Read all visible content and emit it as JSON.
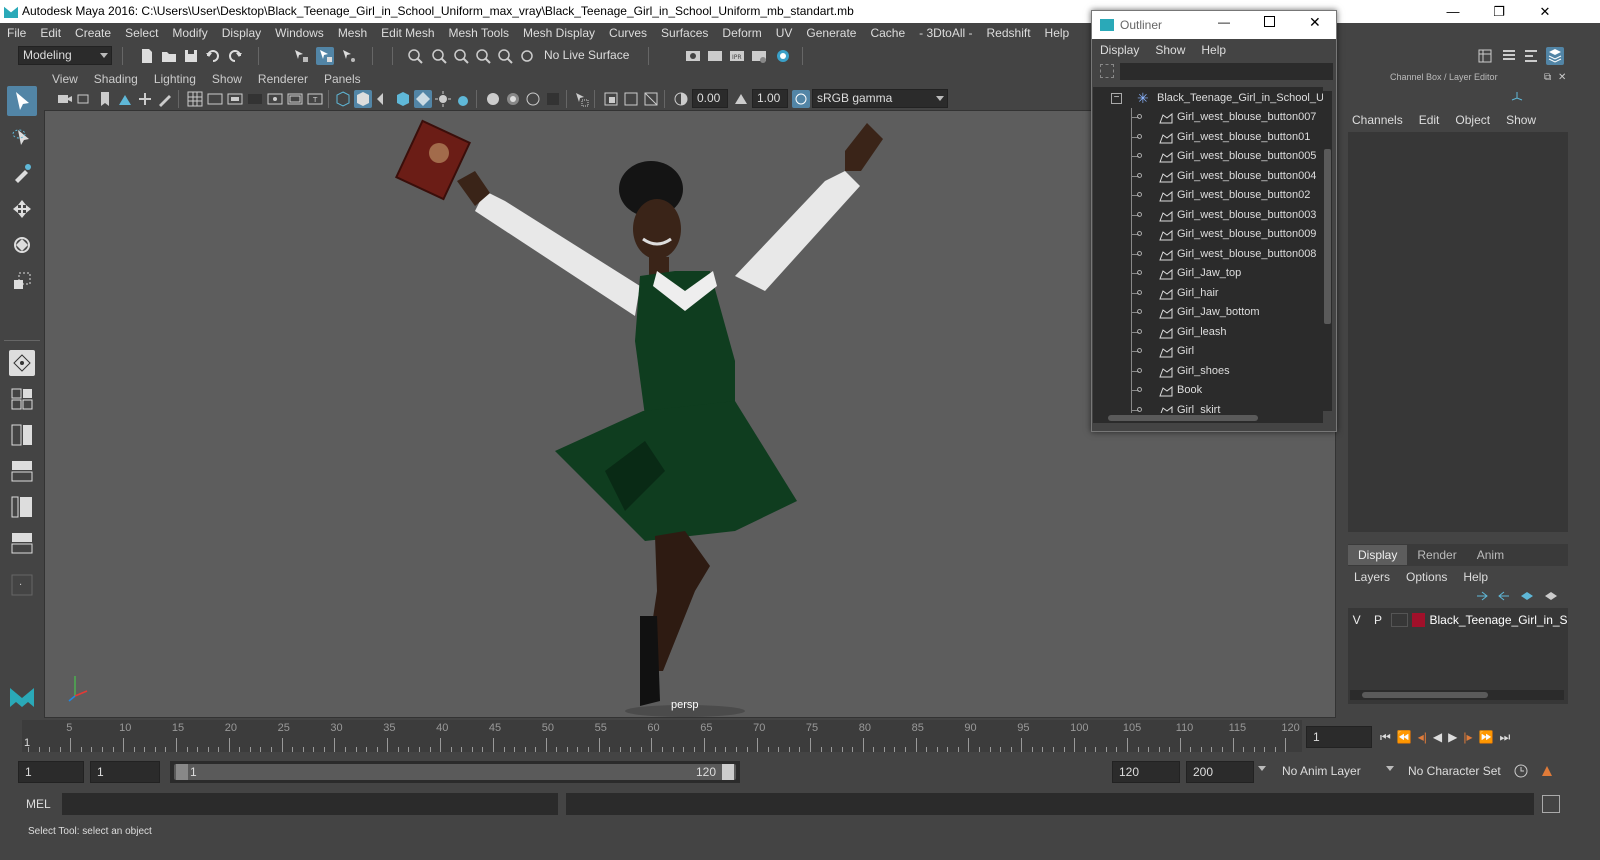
{
  "window": {
    "title": "Autodesk Maya 2016: C:\\Users\\User\\Desktop\\Black_Teenage_Girl_in_School_Uniform_max_vray\\Black_Teenage_Girl_in_School_Uniform_mb_standart.mb",
    "minimize": "—",
    "maximize": "❐",
    "close": "✕"
  },
  "menubar": [
    "File",
    "Edit",
    "Create",
    "Select",
    "Modify",
    "Display",
    "Windows",
    "Mesh",
    "Edit Mesh",
    "Mesh Tools",
    "Mesh Display",
    "Curves",
    "Surfaces",
    "Deform",
    "UV",
    "Generate",
    "Cache",
    "- 3DtoAll -",
    "Redshift",
    "Help"
  ],
  "statusline": {
    "mode": "Modeling",
    "live_surface": "No Live Surface"
  },
  "viewport": {
    "menu": [
      "View",
      "Shading",
      "Lighting",
      "Show",
      "Renderer",
      "Panels"
    ],
    "exposure": "0.00",
    "gamma": "1.00",
    "color_space": "sRGB gamma",
    "camera_label": "persp"
  },
  "outliner": {
    "title": "Outliner",
    "menu": [
      "Display",
      "Show",
      "Help"
    ],
    "root": "Black_Teenage_Girl_in_School_Ur",
    "items": [
      "Girl_west_blouse_button007",
      "Girl_west_blouse_button01",
      "Girl_west_blouse_button005",
      "Girl_west_blouse_button004",
      "Girl_west_blouse_button02",
      "Girl_west_blouse_button003",
      "Girl_west_blouse_button009",
      "Girl_west_blouse_button008",
      "Girl_Jaw_top",
      "Girl_hair",
      "Girl_Jaw_bottom",
      "Girl_leash",
      "Girl",
      "Girl_shoes",
      "Book",
      "Girl_skirt"
    ]
  },
  "channelbox": {
    "header": "Channel Box / Layer Editor",
    "menu": [
      "Channels",
      "Edit",
      "Object",
      "Show"
    ],
    "layer_tabs": [
      "Display",
      "Render",
      "Anim"
    ],
    "layer_menu": [
      "Layers",
      "Options",
      "Help"
    ],
    "layer": {
      "v": "V",
      "p": "P",
      "name": "Black_Teenage_Girl_in_Sc",
      "color": "#a0102a"
    }
  },
  "timeslider": {
    "labels": [
      "5",
      "10",
      "15",
      "20",
      "25",
      "30",
      "35",
      "40",
      "45",
      "50",
      "55",
      "60",
      "65",
      "70",
      "75",
      "80",
      "85",
      "90",
      "95",
      "100",
      "105",
      "110",
      "115",
      "120"
    ],
    "start_marker": "1",
    "current_frame": "1"
  },
  "range": {
    "start": "1",
    "playback_start": "1",
    "range_start": "1",
    "range_end": "120",
    "playback_end": "120",
    "end": "200",
    "anim_layer": "No Anim Layer",
    "character_set": "No Character Set"
  },
  "mel": {
    "label": "MEL"
  },
  "helpline": {
    "text": "Select Tool: select an object"
  },
  "colors": {
    "accent": "#5285a6",
    "bg": "#444444",
    "viewport": "#5d5d5d",
    "dress": "#0f3d1f"
  }
}
